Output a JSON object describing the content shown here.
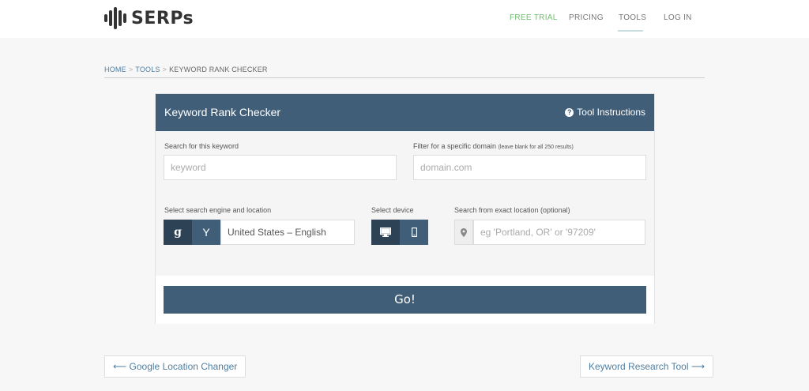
{
  "brand": {
    "name": "SERPs"
  },
  "nav": {
    "free_trial": "FREE TRIAL",
    "pricing": "PRICING",
    "tools": "TOOLS",
    "login": "LOG IN"
  },
  "breadcrumb": {
    "home": "HOME",
    "sep": ">",
    "tools": "TOOLS",
    "current": "KEYWORD RANK CHECKER"
  },
  "card": {
    "title": "Keyword Rank Checker",
    "instructions": "Tool Instructions",
    "keyword_label": "Search for this keyword",
    "keyword_placeholder": "keyword",
    "domain_label": "Filter for a specific domain",
    "domain_hint": "(leave blank for all 250 results)",
    "domain_placeholder": "domain.com",
    "engine_label": "Select search engine and location",
    "engine_google": "g",
    "engine_yahoo": "Y",
    "location_value": "United States – English",
    "device_label": "Select device",
    "exact_label": "Search from exact location (optional)",
    "exact_placeholder": "eg 'Portland, OR' or '97209'",
    "go": "Go!"
  },
  "pager": {
    "prev": "⟵ Google Location Changer",
    "next": "Keyword Research Tool ⟶"
  },
  "colors": {
    "primary": "#415e78",
    "primary_dark": "#2d4355",
    "trial_green": "#6fbd70",
    "link": "#4f7ea1"
  },
  "icons": [
    "logo-bars-icon",
    "question-circle-icon",
    "google-icon",
    "yahoo-icon",
    "desktop-icon",
    "mobile-icon",
    "map-pin-icon"
  ]
}
